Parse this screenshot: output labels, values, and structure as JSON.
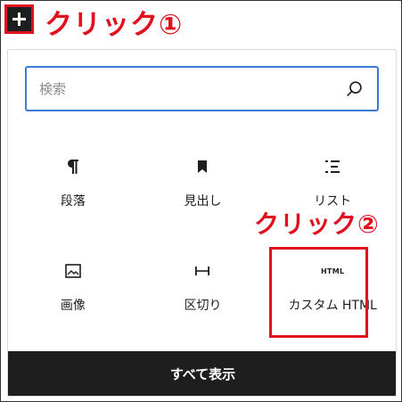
{
  "annotations": {
    "click_1": "クリック①",
    "click_2": "クリック②"
  },
  "search": {
    "placeholder": "検索"
  },
  "blocks": [
    {
      "label": "段落",
      "icon": "paragraph-icon"
    },
    {
      "label": "見出し",
      "icon": "bookmark-icon"
    },
    {
      "label": "リスト",
      "icon": "list-icon"
    },
    {
      "label": "画像",
      "icon": "image-icon"
    },
    {
      "label": "区切り",
      "icon": "separator-icon"
    },
    {
      "label": "カスタム HTML",
      "icon": "html-icon",
      "icon_text": "HTML"
    }
  ],
  "show_all_label": "すべて表示",
  "colors": {
    "annotation_red": "#e0101e",
    "dark": "#1e1e1e",
    "focus_blue": "#3a7bd5"
  }
}
